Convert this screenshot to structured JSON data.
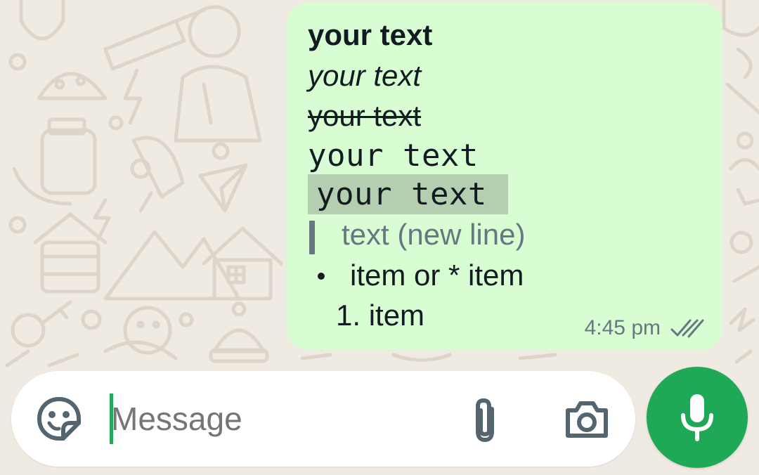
{
  "colors": {
    "wallpaper": "#efeae2",
    "doodle": "#ddd5c9",
    "bubble_outgoing": "#d9fdd3",
    "code_highlight": "#b3cfb0",
    "accent_green": "#1fa855",
    "secondary_text": "#667781",
    "icon_gray": "#54656f"
  },
  "message": {
    "bold": "your text",
    "italic": "your text",
    "strikethrough": "your text",
    "monospace": "your text",
    "inline_code": "your text",
    "quote": "text (new line)",
    "bullet_item": "item or * item",
    "numbered_item": "1. item",
    "time": "4:45 pm",
    "status_icon": "double-check-icon"
  },
  "composer": {
    "placeholder": "Message",
    "emoji_icon": "sticker-icon",
    "attach_icon": "paperclip-icon",
    "camera_icon": "camera-icon",
    "mic_icon": "mic-icon"
  }
}
